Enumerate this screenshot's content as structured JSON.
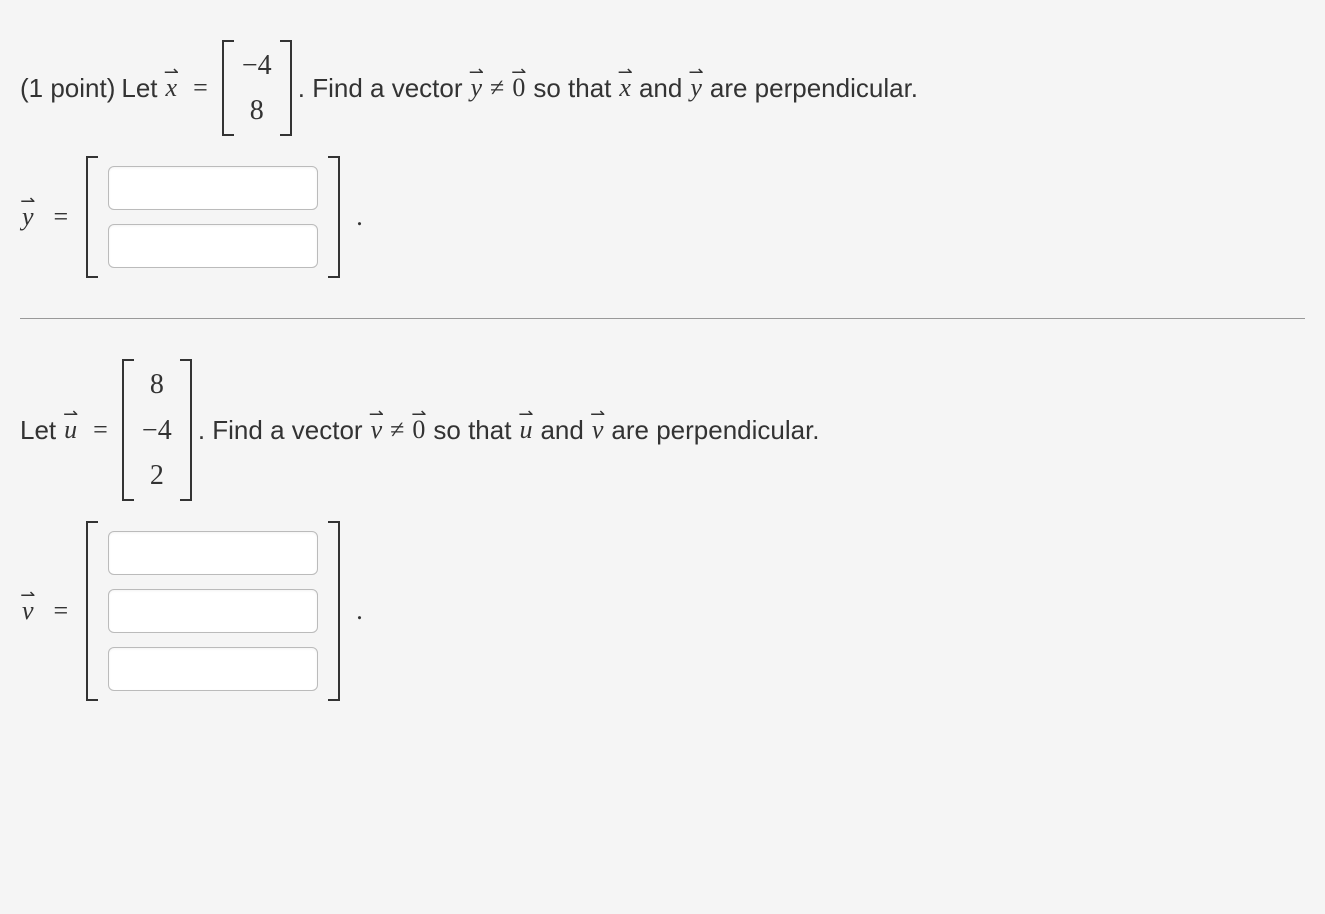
{
  "p1": {
    "points_label": "(1 point)",
    "let_text": "Let",
    "var_x": "x",
    "eq": "=",
    "x_vec": [
      "−4",
      "8"
    ],
    "sentence_parts": {
      "a": ". Find a vector",
      "y": "y",
      "neq": "≠",
      "zero": "0",
      "b": "so that",
      "and": "and",
      "c": "are perpendicular."
    },
    "answer_label": "y",
    "period": "."
  },
  "p2": {
    "let_text": "Let",
    "var_u": "u",
    "eq": "=",
    "u_vec": [
      "8",
      "−4",
      "2"
    ],
    "sentence_parts": {
      "a": ". Find a vector",
      "v": "v",
      "neq": "≠",
      "zero": "0",
      "b": "so that",
      "and": "and",
      "c": "are perpendicular."
    },
    "answer_label": "v",
    "period": "."
  }
}
